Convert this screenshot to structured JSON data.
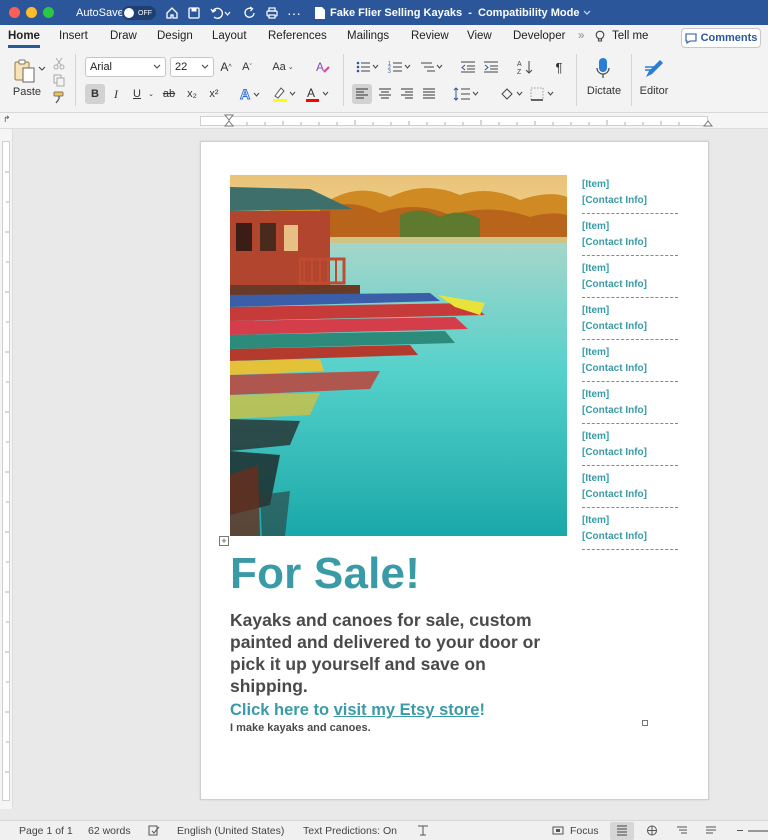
{
  "titlebar": {
    "autosave_label": "AutoSave",
    "autosave_state": "OFF",
    "document_title": "Fake Flier Selling Kayaks",
    "separator": "-",
    "mode": "Compatibility Mode",
    "colors": {
      "bar": "#2b579a",
      "close": "#ff5f57",
      "minimize": "#febc2e",
      "zoom": "#28c840"
    }
  },
  "ribbon_tabs": [
    "Home",
    "Insert",
    "Draw",
    "Design",
    "Layout",
    "References",
    "Mailings",
    "Review",
    "View",
    "Developer"
  ],
  "active_tab": "Home",
  "tell_me": "Tell me",
  "comments_label": "Comments",
  "ribbon": {
    "paste_label": "Paste",
    "font_name": "Arial",
    "font_size": "22",
    "dictate_label": "Dictate",
    "editor_label": "Editor",
    "format_buttons": [
      "B",
      "I",
      "U",
      "ab",
      "x₂",
      "x²"
    ],
    "icons": [
      "paste-icon",
      "cut-icon",
      "copy-icon",
      "format-painter-icon",
      "grow-font-icon",
      "shrink-font-icon",
      "change-case-icon",
      "clear-formatting-icon",
      "bullets-icon",
      "numbering-icon",
      "multilevel-list-icon",
      "decrease-indent-icon",
      "increase-indent-icon",
      "sort-icon",
      "show-marks-icon",
      "align-left-icon",
      "center-icon",
      "align-right-icon",
      "justify-icon",
      "line-spacing-icon",
      "shading-icon",
      "borders-icon",
      "text-effects-icon",
      "highlight-icon",
      "font-color-icon",
      "microphone-icon",
      "editor-pen-icon"
    ],
    "colors": {
      "highlight": "#ffff00",
      "font_color": "#ff0000",
      "accent": "#2b579a"
    }
  },
  "document": {
    "photo_icon": "kayaks-dock-photo",
    "sidebar_items": [
      {
        "item": "[Item]",
        "contact": "[Contact Info]"
      },
      {
        "item": "[Item]",
        "contact": "[Contact Info]"
      },
      {
        "item": "[Item]",
        "contact": "[Contact Info]"
      },
      {
        "item": "[Item]",
        "contact": "[Contact Info]"
      },
      {
        "item": "[Item]",
        "contact": "[Contact Info]"
      },
      {
        "item": "[Item]",
        "contact": "[Contact Info]"
      },
      {
        "item": "[Item]",
        "contact": "[Contact Info]"
      },
      {
        "item": "[Item]",
        "contact": "[Contact Info]"
      },
      {
        "item": "[Item]",
        "contact": "[Contact Info]"
      }
    ],
    "heading": "For Sale!",
    "body": "Kayaks and canoes for sale, custom painted and delivered to your door or pick it up yourself and save on shipping.",
    "link_prefix": "Click here to ",
    "link_text": "visit my Etsy store",
    "link_suffix": "!",
    "note": "I make kayaks and canoes.",
    "accent_color": "#3a9ba6",
    "text_color": "#4a4a4a"
  },
  "statusbar": {
    "page": "Page 1 of 1",
    "words": "62 words",
    "language": "English (United States)",
    "predictions": "Text Predictions: On",
    "focus": "Focus"
  }
}
